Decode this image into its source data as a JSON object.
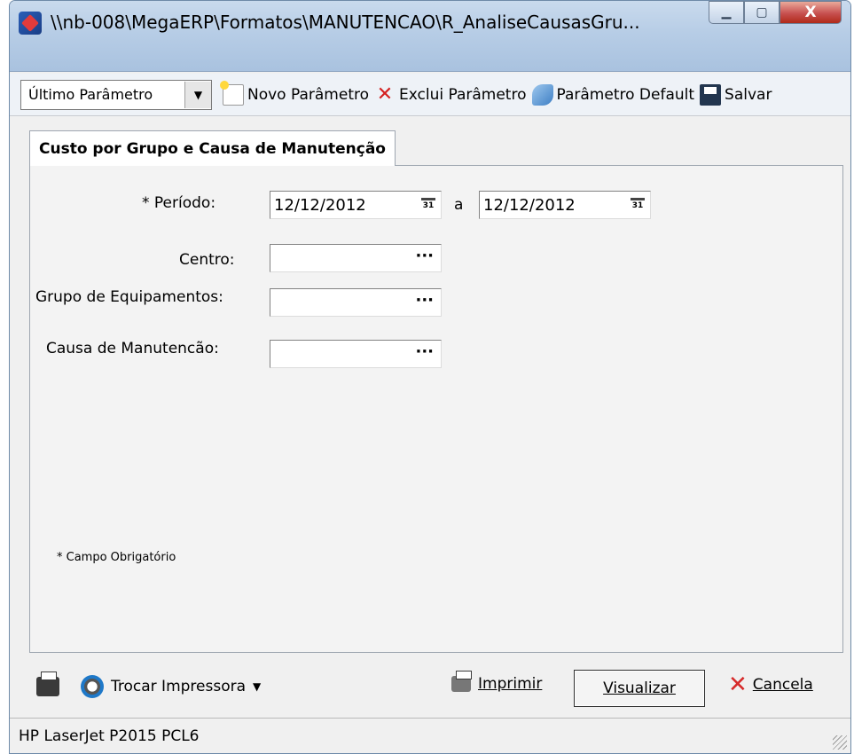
{
  "window": {
    "title": "\\\\nb-008\\MegaERP\\Formatos\\MANUTENCAO\\R_AnaliseCausasGru...",
    "minimize_glyph": "▁",
    "maximize_glyph": "▢",
    "close_glyph": "X"
  },
  "toolbar": {
    "param_select": "Último Parâmetro",
    "new_label": "Novo Parâmetro",
    "delete_label": "Exclui Parâmetro",
    "default_label": "Parâmetro Default",
    "save_label": "Salvar"
  },
  "tab": {
    "label": "Custo por Grupo e Causa de Manutenção"
  },
  "form": {
    "periodo_label": "* Período:",
    "periodo_from": "12/12/2012",
    "periodo_sep": "a",
    "periodo_to": "12/12/2012",
    "centro_label": "Centro:",
    "centro_value": "",
    "grupo_label": "Grupo de Equipamentos:",
    "grupo_value": "",
    "causa_label": "Causa de Manutencão:",
    "causa_value": "",
    "lookup_glyph": "···",
    "calendar_glyph": "31",
    "required_note": "* Campo Obrigatório"
  },
  "actions": {
    "switch_printer_label": "Trocar Impressora",
    "print_label": "Imprimir",
    "preview_label": "Visualizar",
    "cancel_label": "Cancela"
  },
  "statusbar": {
    "printer": "HP LaserJet P2015 PCL6"
  },
  "colors": {
    "titlebar": "#b7cde6",
    "close_button": "#c75050",
    "window_bg": "#f0f0f0"
  }
}
